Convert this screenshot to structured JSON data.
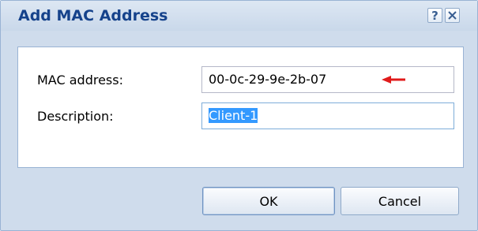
{
  "dialog": {
    "title": "Add MAC Address",
    "help_icon": "?",
    "close_icon": "close-icon"
  },
  "form": {
    "mac_label": "MAC address:",
    "mac_value": "00-0c-29-9e-2b-07",
    "description_label": "Description:",
    "description_value": "Client-1"
  },
  "annotation": {
    "arrow_color": "#e01b1b",
    "arrow_icon": "left-arrow-annotation-icon"
  },
  "buttons": {
    "ok_label": "OK",
    "cancel_label": "Cancel"
  },
  "colors": {
    "title_text": "#15428b",
    "window_bg": "#cfdcec",
    "selection": "#3399ff"
  }
}
